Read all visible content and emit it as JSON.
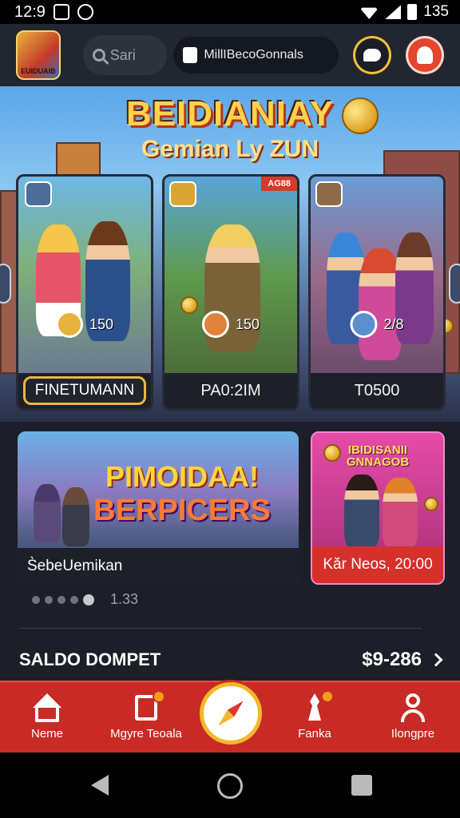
{
  "status_bar": {
    "time": "12:9",
    "battery": "135"
  },
  "header": {
    "logo_text": "EUIDUAIB",
    "search_placeholder": "Sari",
    "wallet_label": "MillIBecoGonnals"
  },
  "hero": {
    "title": "BEIDIANIAY",
    "subtitle": "Gemian Ly ZUN",
    "cards": [
      {
        "price": "150",
        "button_label": "FINETUMANN"
      },
      {
        "price": "150",
        "footer_text": "PA0:2IM",
        "ribbon": "AG88"
      },
      {
        "price": "2/8",
        "footer_text": "T0500"
      }
    ]
  },
  "promos": [
    {
      "title_line1": "PIMOIDAA!",
      "title_line2": "BERPICERS",
      "caption": "S̀ebeUemikan"
    },
    {
      "title": "IBIDISANII\nGNNAGOB",
      "caption": "Kăr Neos, 20:00"
    }
  ],
  "pager": {
    "count_text": "1.33"
  },
  "balance": {
    "label": "SALDO DOMPET",
    "value": "$9-286"
  },
  "tabs": [
    {
      "label": "Neme",
      "icon": "home-icon"
    },
    {
      "label": "Mgyre Teoala",
      "icon": "document-icon"
    },
    {
      "label": "Fanka",
      "icon": "chess-pawn-icon"
    },
    {
      "label": "Ilongpre",
      "icon": "person-icon"
    }
  ],
  "colors": {
    "tabbar": "#c82a25",
    "accent_gold": "#e9b83a",
    "header_bg": "#222630"
  }
}
